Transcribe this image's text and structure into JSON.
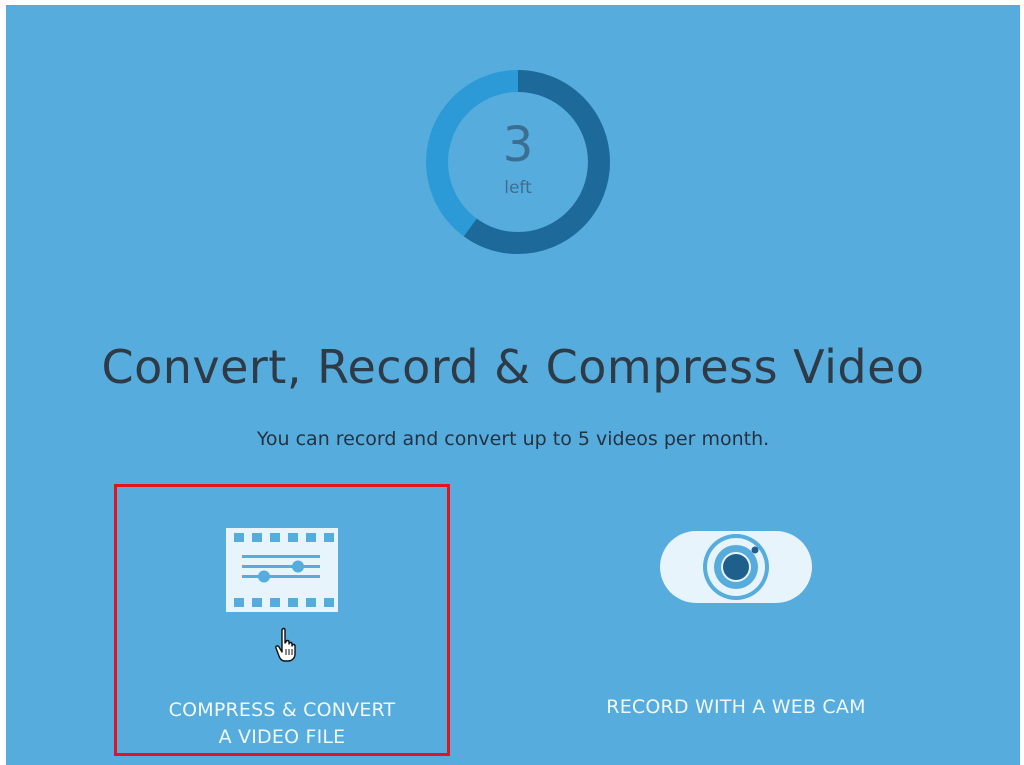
{
  "counter": {
    "remaining": "3",
    "remaining_label": "left",
    "used_fraction": 0.6,
    "track_color": "#2c9ad6",
    "progress_color": "#1d6a9a"
  },
  "headline": "Convert, Record & Compress Video",
  "subline": "You can record and convert up to 5 videos per month.",
  "options": [
    {
      "icon": "film-sliders-icon",
      "label_line1": "COMPRESS & CONVERT",
      "label_line2": "A VIDEO FILE",
      "highlighted": true
    },
    {
      "icon": "webcam-icon",
      "label_line1": "RECORD WITH A WEB CAM"
    }
  ],
  "colors": {
    "background": "#55acdd",
    "headline": "#2e3b46",
    "highlight_border": "#e3141f",
    "icon_fill": "#e8f4fb"
  }
}
